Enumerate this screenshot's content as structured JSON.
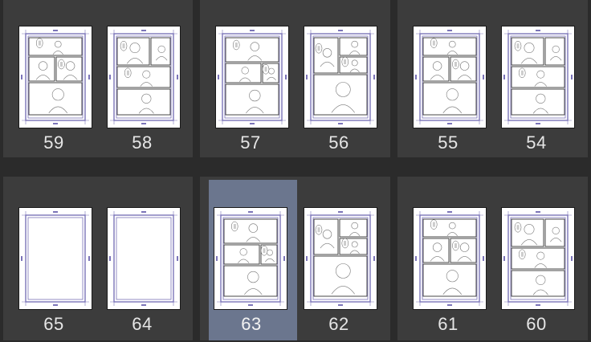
{
  "spreads": [
    {
      "pages": [
        {
          "number": "59",
          "content": "manga"
        },
        {
          "number": "58",
          "content": "manga"
        }
      ]
    },
    {
      "pages": [
        {
          "number": "57",
          "content": "manga"
        },
        {
          "number": "56",
          "content": "manga"
        }
      ]
    },
    {
      "pages": [
        {
          "number": "55",
          "content": "manga"
        },
        {
          "number": "54",
          "content": "manga"
        }
      ]
    },
    {
      "pages": [
        {
          "number": "65",
          "content": "blank"
        },
        {
          "number": "64",
          "content": "blank"
        }
      ]
    },
    {
      "pages": [
        {
          "number": "63",
          "content": "manga",
          "selected": true
        },
        {
          "number": "62",
          "content": "manga"
        }
      ]
    },
    {
      "pages": [
        {
          "number": "61",
          "content": "manga"
        },
        {
          "number": "60",
          "content": "manga"
        }
      ]
    }
  ],
  "colors": {
    "background": "#2b2b2b",
    "spread": "#3c3c3c",
    "selected": "#6b768e",
    "guide": "#7b74b8",
    "ink": "#333333"
  }
}
